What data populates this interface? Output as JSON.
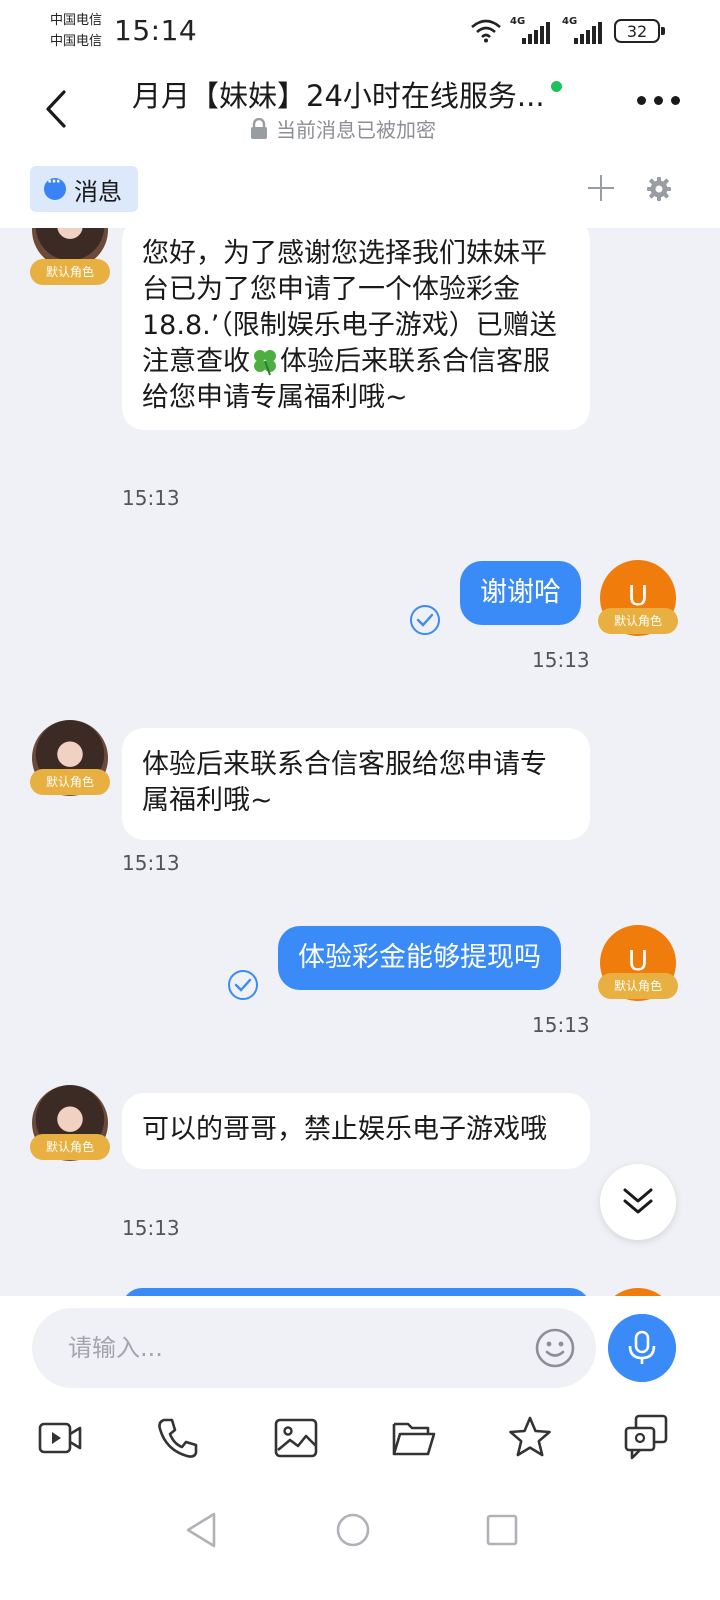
{
  "status_bar": {
    "carrier1": "中国电信",
    "carrier2": "中国电信",
    "time": "15:14",
    "network1": "4G",
    "network2": "4G",
    "battery": "32"
  },
  "header": {
    "title": "月月【妹妹】24小时在线服务...",
    "subtitle": "当前消息已被加密"
  },
  "tab": {
    "label": "消息"
  },
  "messages": [
    {
      "from": "agent",
      "text_before": "您好，为了感谢您选择我们妹妹平台已为了您申请了一个体验彩金18.8.’（限制娱乐电子游戏）已赠送注意查收",
      "text_after": "体验后来联系合信客服给您申请专属福利哦~",
      "time": "15:13",
      "role": "默认角色"
    },
    {
      "from": "user",
      "text": "谢谢哈",
      "time": "15:13",
      "role": "默认角色",
      "avatar": "U"
    },
    {
      "from": "agent",
      "text": "体验后来联系合信客服给您申请专属福利哦~",
      "time": "15:13",
      "role": "默认角色"
    },
    {
      "from": "user",
      "text": "体验彩金能够提现吗",
      "time": "15:13",
      "role": "默认角色",
      "avatar": "U"
    },
    {
      "from": "agent",
      "text": "可以的哥哥，禁止娱乐电子游戏哦",
      "time": "15:13",
      "role": "默认角色"
    }
  ],
  "composer": {
    "placeholder": "请输入...",
    "tools": [
      "video-icon",
      "phone-icon",
      "image-icon",
      "folder-icon",
      "star-icon",
      "screen-share-icon"
    ]
  },
  "colors": {
    "accent": "#3a8bf7",
    "user_avatar": "#f07d0b",
    "badge": "#e7b040",
    "online": "#20c05c"
  }
}
